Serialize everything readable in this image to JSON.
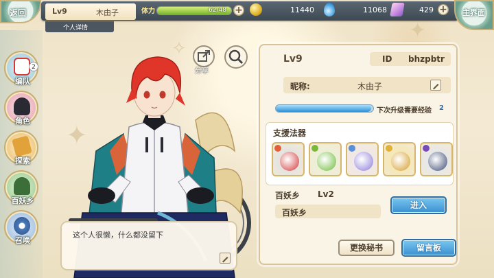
{
  "header": {
    "back_label": "返回",
    "level": "Lv9",
    "player_name": "木由子",
    "detail_tab": "个人详情",
    "stamina_label": "体力",
    "stamina_text": "62/48",
    "stamina_fraction": 1.0,
    "coins": "11440",
    "water": "11068",
    "gems": "429",
    "main_menu_label": "主界面"
  },
  "sidebar": {
    "items": [
      {
        "label": "编队",
        "badge": "2"
      },
      {
        "label": "角色"
      },
      {
        "label": "探索"
      },
      {
        "label": "百妖乡"
      },
      {
        "label": "召唤"
      }
    ]
  },
  "character": {
    "share_label": "分享",
    "signature": "这个人很懒，什么都没留下"
  },
  "profile": {
    "level": "Lv9",
    "id_label": "ID",
    "id_value": "bhzpbtr",
    "nickname_label": "昵称:",
    "nickname_value": "木由子",
    "xp_label": "下次升级需要经验",
    "xp_value": "2",
    "xp_fraction": 0.98,
    "support_title": "支援法器",
    "support_items": [
      {
        "gem_color": "#e2603a",
        "item_color": "#d9dfe8",
        "accent": "#d23a3a"
      },
      {
        "gem_color": "#7ab83a",
        "item_color": "#eaf3d6",
        "accent": "#6fbb3a"
      },
      {
        "gem_color": "#5a8fd8",
        "item_color": "#efe6f5",
        "accent": "#8d7bd8"
      },
      {
        "gem_color": "#e2b13a",
        "item_color": "#f7e6a0",
        "accent": "#d49c2a"
      },
      {
        "gem_color": "#7a4ab8",
        "item_color": "#dfe6f3",
        "accent": "#3b4a72"
      }
    ],
    "yokai_name": "百妖乡",
    "yokai_level": "Lv2",
    "yokai_sub": "百妖乡",
    "enter_button": "进入",
    "change_secretary_button": "更换秘书",
    "message_board_button": "留言板"
  }
}
